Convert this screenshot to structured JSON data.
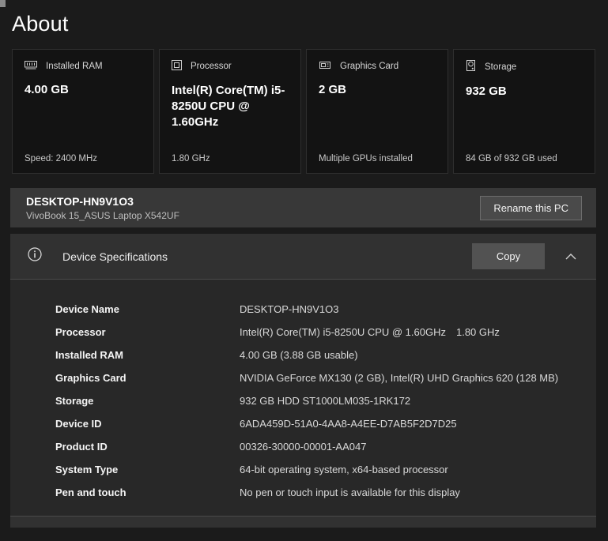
{
  "page": {
    "title": "About"
  },
  "cards": [
    {
      "icon": "ram-icon",
      "label": "Installed RAM",
      "value": "4.00 GB",
      "caption": "Speed: 2400 MHz"
    },
    {
      "icon": "cpu-icon",
      "label": "Processor",
      "value": "Intel(R) Core(TM) i5-8250U CPU @ 1.60GHz",
      "caption": "1.80 GHz"
    },
    {
      "icon": "gpu-icon",
      "label": "Graphics Card",
      "value": "2 GB",
      "caption": "Multiple GPUs installed"
    },
    {
      "icon": "storage-icon",
      "label": "Storage",
      "value": "932 GB",
      "caption": "84 GB of 932 GB used"
    }
  ],
  "device_bar": {
    "name": "DESKTOP-HN9V1O3",
    "model": "VivoBook 15_ASUS Laptop X542UF",
    "rename_button": "Rename this PC"
  },
  "specs_section": {
    "title": "Device Specifications",
    "copy_button": "Copy",
    "rows": [
      {
        "label": "Device Name",
        "value": "DESKTOP-HN9V1O3"
      },
      {
        "label": "Processor",
        "value": "Intel(R) Core(TM) i5-8250U CPU @ 1.60GHz  1.80 GHz"
      },
      {
        "label": "Installed RAM",
        "value": "4.00 GB (3.88 GB usable)"
      },
      {
        "label": "Graphics Card",
        "value": "NVIDIA GeForce MX130 (2 GB), Intel(R) UHD Graphics 620 (128 MB)"
      },
      {
        "label": "Storage",
        "value": "932 GB HDD ST1000LM035-1RK172"
      },
      {
        "label": "Device ID",
        "value": "6ADA459D-51A0-4AA8-A4EE-D7AB5F2D7D25"
      },
      {
        "label": "Product ID",
        "value": "00326-30000-00001-AA047"
      },
      {
        "label": "System Type",
        "value": "64-bit operating system, x64-based processor"
      },
      {
        "label": "Pen and touch",
        "value": "No pen or touch input is available for this display"
      }
    ]
  },
  "colors": {
    "page_bg": "#1b1b1b",
    "card_bg": "#131313",
    "device_bar_bg": "#383838",
    "panel_bg": "#282828",
    "panel_header_bg": "#313131",
    "button_bg": "#4a4a4a",
    "divider": "#4a4a4a"
  }
}
